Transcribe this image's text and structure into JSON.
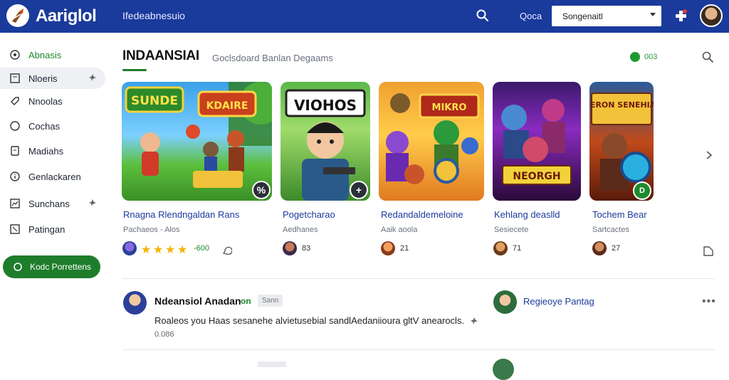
{
  "header": {
    "brand": "Aariglol",
    "nav_label": "Ifedeabnesuio",
    "link_label": "Qoca",
    "select_value": "Songenaitl"
  },
  "sidebar": {
    "items": [
      {
        "label": "Abnasis",
        "icon": "gauge-icon"
      },
      {
        "label": "Nloeris",
        "icon": "doc-icon"
      },
      {
        "label": "Nnoolas",
        "icon": "tag-icon"
      },
      {
        "label": "Cochas",
        "icon": "circle-icon"
      },
      {
        "label": "Madiahs",
        "icon": "note-icon"
      },
      {
        "label": "Genlackaren",
        "icon": "info-icon"
      },
      {
        "label": "Sunchans",
        "icon": "chart-icon"
      },
      {
        "label": "Patingan",
        "icon": "trend-icon"
      }
    ],
    "cta_label": "Kodc Porrettens"
  },
  "main": {
    "title": "INDAANSIAI",
    "subtitle": "Goclsdoard Banlan Degaams",
    "status_text": "003"
  },
  "cards": [
    {
      "title": "Rnagna Rlendngaldan Rans",
      "sub": "Pachaeos - Alos",
      "meta": "-600",
      "image_text": "SUNDE",
      "image_text2": "KDAIRE",
      "badge": "%"
    },
    {
      "title": "Pogetcharao",
      "sub": "Aedhanes",
      "meta": "83",
      "image_text": "VIOHOS",
      "badge": "+"
    },
    {
      "title": "Redandaldemeloine",
      "sub": "Aaik aoola",
      "meta": "21",
      "image_text": "MIKRO",
      "badge": ""
    },
    {
      "title": "Kehlang deaslld",
      "sub": "Sesiecete",
      "meta": "71",
      "image_text": "NEORGH",
      "badge": ""
    },
    {
      "title": "Tochem Bear",
      "sub": "Sartcactes",
      "meta": "27",
      "image_text": "WERON SENEHIAS",
      "badge": "D"
    }
  ],
  "post": {
    "author": "Ndeansiol Anadan",
    "badge": "on",
    "tag": "Sann",
    "text": "Roaleos you Haas sesanehe alvietusebial sandlAedaniioura gltV anearocls.",
    "meta": "0.086",
    "right_name": "Regieoye Pantag"
  }
}
